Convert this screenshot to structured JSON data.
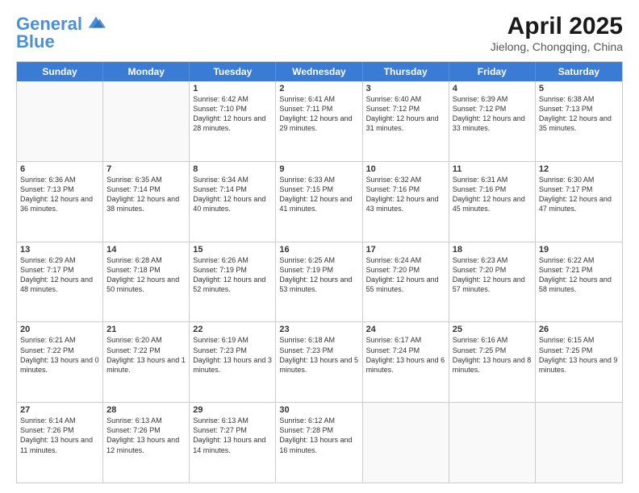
{
  "header": {
    "logo_line1": "General",
    "logo_line2": "Blue",
    "main_title": "April 2025",
    "subtitle": "Jielong, Chongqing, China"
  },
  "days_of_week": [
    "Sunday",
    "Monday",
    "Tuesday",
    "Wednesday",
    "Thursday",
    "Friday",
    "Saturday"
  ],
  "weeks": [
    [
      {
        "day": "",
        "info": ""
      },
      {
        "day": "",
        "info": ""
      },
      {
        "day": "1",
        "info": "Sunrise: 6:42 AM\nSunset: 7:10 PM\nDaylight: 12 hours and 28 minutes."
      },
      {
        "day": "2",
        "info": "Sunrise: 6:41 AM\nSunset: 7:11 PM\nDaylight: 12 hours and 29 minutes."
      },
      {
        "day": "3",
        "info": "Sunrise: 6:40 AM\nSunset: 7:12 PM\nDaylight: 12 hours and 31 minutes."
      },
      {
        "day": "4",
        "info": "Sunrise: 6:39 AM\nSunset: 7:12 PM\nDaylight: 12 hours and 33 minutes."
      },
      {
        "day": "5",
        "info": "Sunrise: 6:38 AM\nSunset: 7:13 PM\nDaylight: 12 hours and 35 minutes."
      }
    ],
    [
      {
        "day": "6",
        "info": "Sunrise: 6:36 AM\nSunset: 7:13 PM\nDaylight: 12 hours and 36 minutes."
      },
      {
        "day": "7",
        "info": "Sunrise: 6:35 AM\nSunset: 7:14 PM\nDaylight: 12 hours and 38 minutes."
      },
      {
        "day": "8",
        "info": "Sunrise: 6:34 AM\nSunset: 7:14 PM\nDaylight: 12 hours and 40 minutes."
      },
      {
        "day": "9",
        "info": "Sunrise: 6:33 AM\nSunset: 7:15 PM\nDaylight: 12 hours and 41 minutes."
      },
      {
        "day": "10",
        "info": "Sunrise: 6:32 AM\nSunset: 7:16 PM\nDaylight: 12 hours and 43 minutes."
      },
      {
        "day": "11",
        "info": "Sunrise: 6:31 AM\nSunset: 7:16 PM\nDaylight: 12 hours and 45 minutes."
      },
      {
        "day": "12",
        "info": "Sunrise: 6:30 AM\nSunset: 7:17 PM\nDaylight: 12 hours and 47 minutes."
      }
    ],
    [
      {
        "day": "13",
        "info": "Sunrise: 6:29 AM\nSunset: 7:17 PM\nDaylight: 12 hours and 48 minutes."
      },
      {
        "day": "14",
        "info": "Sunrise: 6:28 AM\nSunset: 7:18 PM\nDaylight: 12 hours and 50 minutes."
      },
      {
        "day": "15",
        "info": "Sunrise: 6:26 AM\nSunset: 7:19 PM\nDaylight: 12 hours and 52 minutes."
      },
      {
        "day": "16",
        "info": "Sunrise: 6:25 AM\nSunset: 7:19 PM\nDaylight: 12 hours and 53 minutes."
      },
      {
        "day": "17",
        "info": "Sunrise: 6:24 AM\nSunset: 7:20 PM\nDaylight: 12 hours and 55 minutes."
      },
      {
        "day": "18",
        "info": "Sunrise: 6:23 AM\nSunset: 7:20 PM\nDaylight: 12 hours and 57 minutes."
      },
      {
        "day": "19",
        "info": "Sunrise: 6:22 AM\nSunset: 7:21 PM\nDaylight: 12 hours and 58 minutes."
      }
    ],
    [
      {
        "day": "20",
        "info": "Sunrise: 6:21 AM\nSunset: 7:22 PM\nDaylight: 13 hours and 0 minutes."
      },
      {
        "day": "21",
        "info": "Sunrise: 6:20 AM\nSunset: 7:22 PM\nDaylight: 13 hours and 1 minute."
      },
      {
        "day": "22",
        "info": "Sunrise: 6:19 AM\nSunset: 7:23 PM\nDaylight: 13 hours and 3 minutes."
      },
      {
        "day": "23",
        "info": "Sunrise: 6:18 AM\nSunset: 7:23 PM\nDaylight: 13 hours and 5 minutes."
      },
      {
        "day": "24",
        "info": "Sunrise: 6:17 AM\nSunset: 7:24 PM\nDaylight: 13 hours and 6 minutes."
      },
      {
        "day": "25",
        "info": "Sunrise: 6:16 AM\nSunset: 7:25 PM\nDaylight: 13 hours and 8 minutes."
      },
      {
        "day": "26",
        "info": "Sunrise: 6:15 AM\nSunset: 7:25 PM\nDaylight: 13 hours and 9 minutes."
      }
    ],
    [
      {
        "day": "27",
        "info": "Sunrise: 6:14 AM\nSunset: 7:26 PM\nDaylight: 13 hours and 11 minutes."
      },
      {
        "day": "28",
        "info": "Sunrise: 6:13 AM\nSunset: 7:26 PM\nDaylight: 13 hours and 12 minutes."
      },
      {
        "day": "29",
        "info": "Sunrise: 6:13 AM\nSunset: 7:27 PM\nDaylight: 13 hours and 14 minutes."
      },
      {
        "day": "30",
        "info": "Sunrise: 6:12 AM\nSunset: 7:28 PM\nDaylight: 13 hours and 16 minutes."
      },
      {
        "day": "",
        "info": ""
      },
      {
        "day": "",
        "info": ""
      },
      {
        "day": "",
        "info": ""
      }
    ]
  ]
}
